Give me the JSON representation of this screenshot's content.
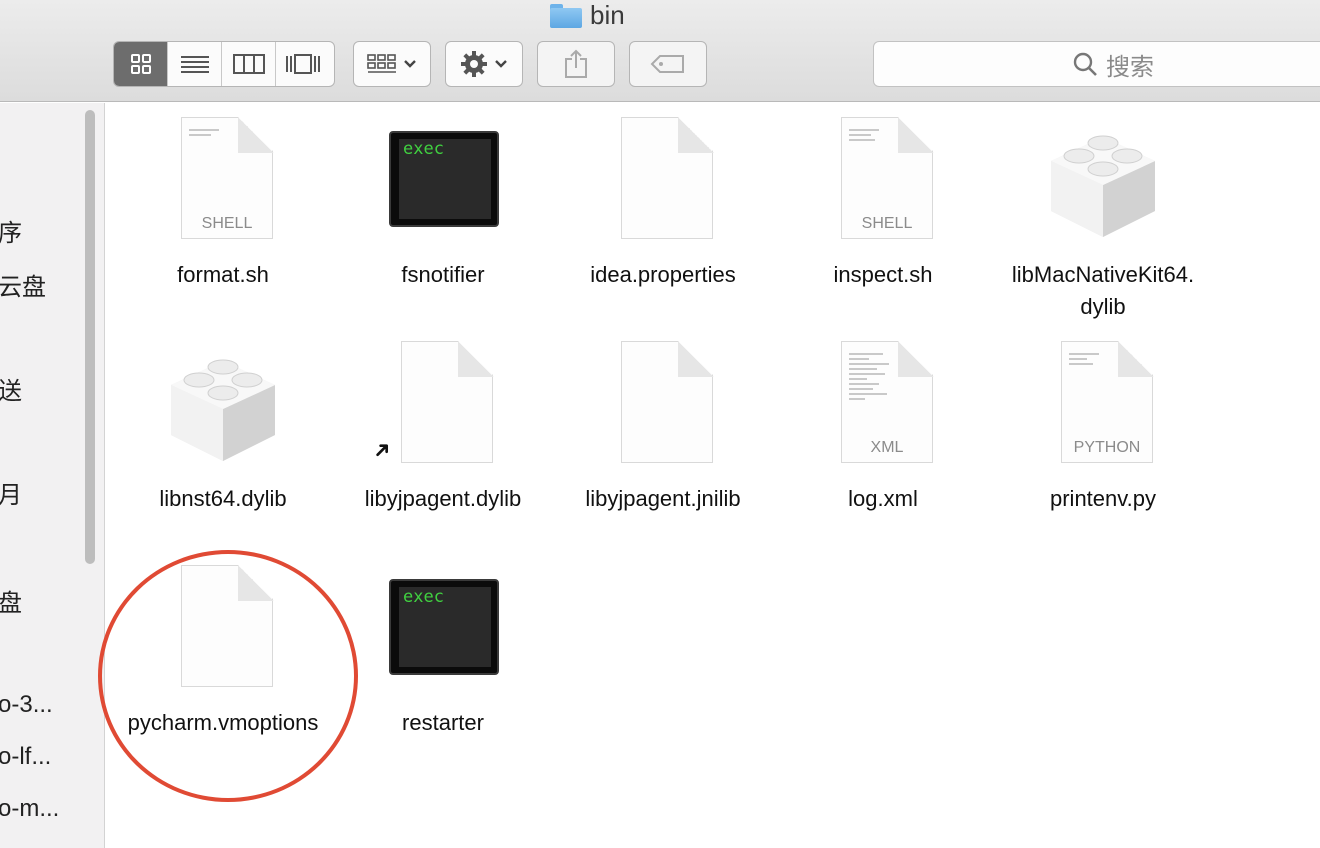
{
  "window": {
    "title": "bin"
  },
  "toolbar": {
    "view_modes": [
      "icon-view",
      "list-view",
      "column-view",
      "cover-flow-view"
    ],
    "search": {
      "placeholder": "搜索"
    }
  },
  "sidebar": {
    "items": [
      "序",
      "云盘",
      "送",
      "月",
      "盘",
      "o-3...",
      "o-lf...",
      "o-m..."
    ]
  },
  "files": [
    {
      "name": "format.sh",
      "kind": "doc",
      "type_label": "SHELL"
    },
    {
      "name": "fsnotifier",
      "kind": "exec",
      "exec_label": "exec"
    },
    {
      "name": "idea.properties",
      "kind": "doc",
      "type_label": ""
    },
    {
      "name": "inspect.sh",
      "kind": "doc",
      "type_label": "SHELL"
    },
    {
      "name": "libMacNativeKit64.dylib",
      "kind": "lib"
    },
    {
      "name": "libnst64.dylib",
      "kind": "lib"
    },
    {
      "name": "libyjpagent.dylib",
      "kind": "alias"
    },
    {
      "name": "libyjpagent.jnilib",
      "kind": "doc",
      "type_label": ""
    },
    {
      "name": "log.xml",
      "kind": "doc",
      "type_label": "XML"
    },
    {
      "name": "printenv.py",
      "kind": "doc",
      "type_label": "PYTHON"
    },
    {
      "name": "pycharm.vmoptions",
      "kind": "doc",
      "type_label": ""
    },
    {
      "name": "restarter",
      "kind": "exec",
      "exec_label": "exec"
    }
  ],
  "colors": {
    "highlight_circle": "#e04a34",
    "exec_text": "#40d040",
    "folder_blue": "#5da7e3"
  }
}
